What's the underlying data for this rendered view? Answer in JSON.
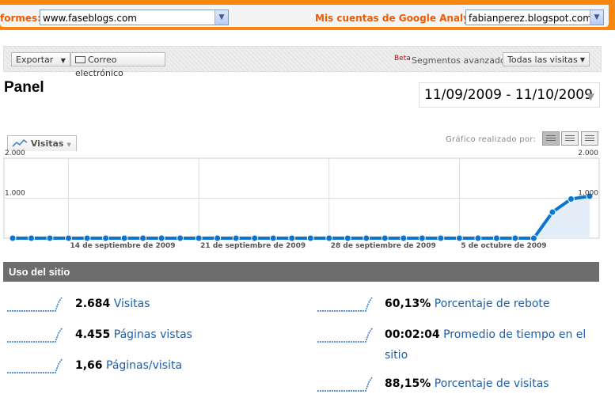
{
  "topbar": {
    "reports_label": "formes:",
    "reports_value": "www.faseblogs.com",
    "accounts_label": "Mis cuentas de Google Analytics:",
    "accounts_value": "fabianperez.blogspot.com"
  },
  "toolbar": {
    "export_label": "Exportar",
    "email_label": "Correo electrónico",
    "beta_label": "Beta",
    "segments_label": "Segmentos avanzados:",
    "segments_value": "Todas las visitas"
  },
  "page": {
    "title": "Panel",
    "date_range": "11/09/2009 - 11/10/2009"
  },
  "graph": {
    "metric_tab": "Visitas",
    "graph_by_label": "Gráfico realizado por:"
  },
  "chart_data": {
    "type": "line",
    "series": [
      {
        "values": [
          0,
          0,
          0,
          0,
          0,
          0,
          0,
          0,
          0,
          0,
          0,
          0,
          0,
          0,
          0,
          0,
          0,
          0,
          0,
          0,
          0,
          0,
          0,
          0,
          0,
          0,
          0,
          0,
          0,
          650,
          980,
          1050
        ]
      }
    ],
    "ylim": [
      0,
      2000
    ],
    "y_ticks": [
      "2.000",
      "1.000"
    ],
    "x_tick_labels": [
      "14 de septiembre de 2009",
      "21 de septiembre de 2009",
      "28 de septiembre de 2009",
      "5 de octubre de 2009"
    ],
    "line_color": "#0a76cf",
    "fill": true,
    "grid": true
  },
  "section": {
    "title": "Uso del sitio"
  },
  "metrics": {
    "left": [
      {
        "value": "2.684",
        "label": "Visitas"
      },
      {
        "value": "4.455",
        "label": "Páginas vistas"
      },
      {
        "value": "1,66",
        "label": "Páginas/visita"
      }
    ],
    "right": [
      {
        "value": "60,13%",
        "label": "Porcentaje de rebote"
      },
      {
        "value": "00:02:04",
        "label": "Promedio de tiempo en el"
      },
      {
        "value": "",
        "label": "sitio"
      },
      {
        "value": "88,15%",
        "label": "Porcentaje de visitas"
      }
    ]
  }
}
